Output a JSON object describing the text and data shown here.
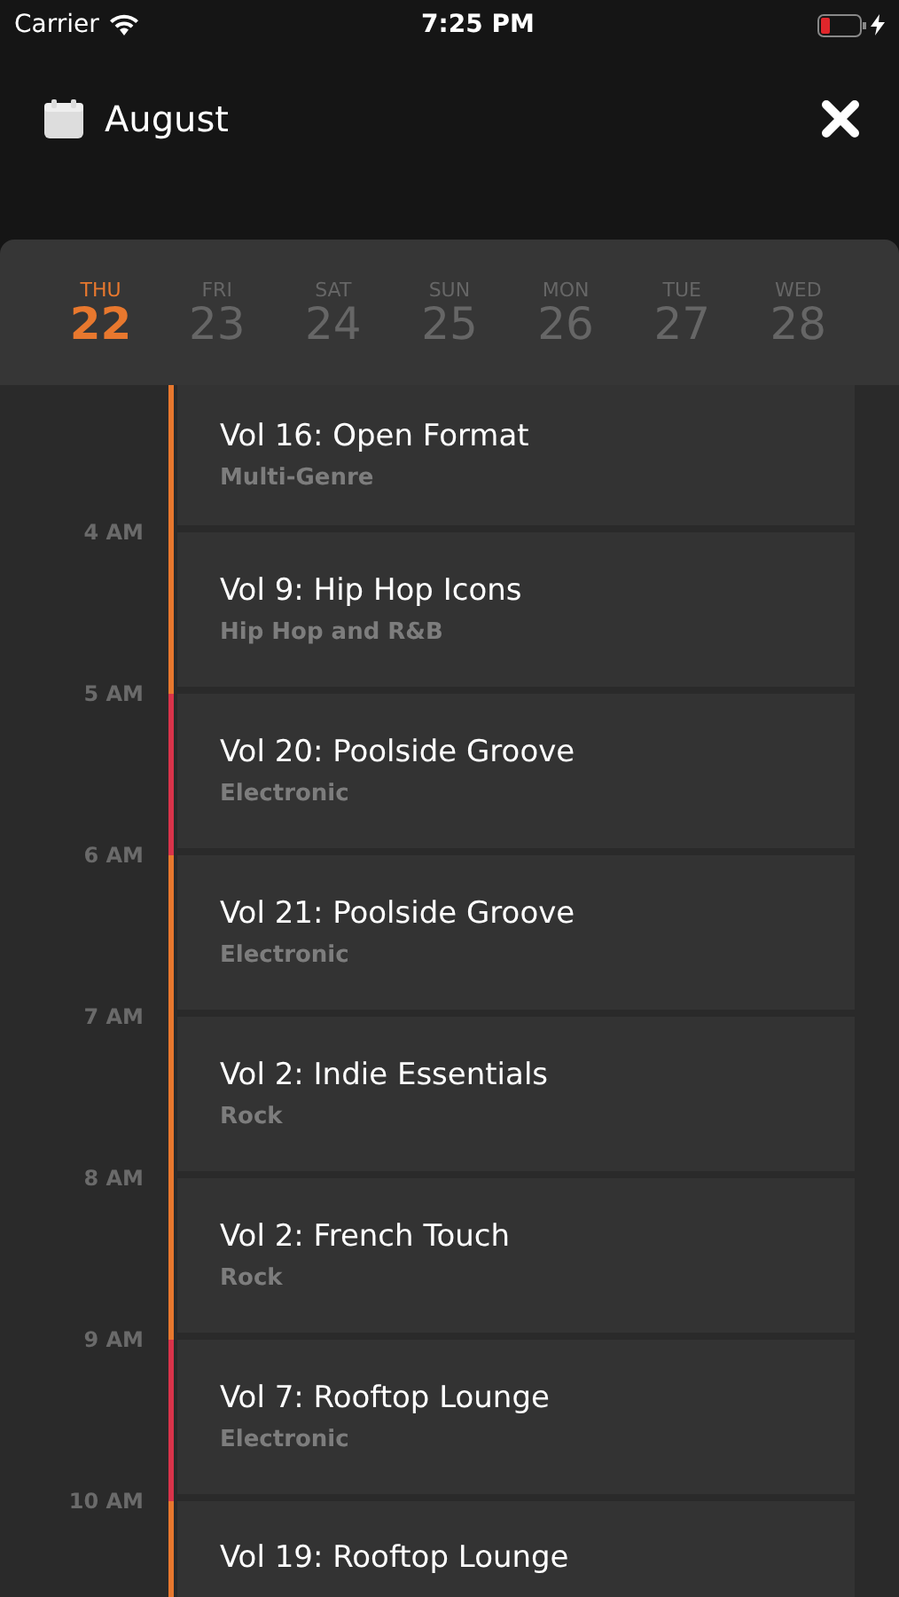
{
  "status_bar": {
    "carrier": "Carrier",
    "time": "7:25 PM"
  },
  "header": {
    "title": "August"
  },
  "days": [
    {
      "weekday": "THU",
      "date": "22",
      "selected": true
    },
    {
      "weekday": "FRI",
      "date": "23",
      "selected": false
    },
    {
      "weekday": "SAT",
      "date": "24",
      "selected": false
    },
    {
      "weekday": "SUN",
      "date": "25",
      "selected": false
    },
    {
      "weekday": "MON",
      "date": "26",
      "selected": false
    },
    {
      "weekday": "TUE",
      "date": "27",
      "selected": false
    },
    {
      "weekday": "WED",
      "date": "28",
      "selected": false
    }
  ],
  "events": [
    {
      "title": "Vol 16: Open Format",
      "genre": "Multi-Genre",
      "color": "#e8782e",
      "hour_below": "4 AM"
    },
    {
      "title": "Vol 9: Hip Hop Icons",
      "genre": "Hip Hop and R&B",
      "color": "#e8782e",
      "hour_below": "5 AM"
    },
    {
      "title": "Vol 20: Poolside Groove",
      "genre": "Electronic",
      "color": "#d9334a",
      "hour_below": "6 AM"
    },
    {
      "title": "Vol 21: Poolside Groove",
      "genre": "Electronic",
      "color": "#e8782e",
      "hour_below": "7 AM"
    },
    {
      "title": "Vol 2: Indie Essentials",
      "genre": "Rock",
      "color": "#e8782e",
      "hour_below": "8 AM"
    },
    {
      "title": "Vol 2: French Touch",
      "genre": "Rock",
      "color": "#e8782e",
      "hour_below": "9 AM"
    },
    {
      "title": "Vol 7: Rooftop Lounge",
      "genre": "Electronic",
      "color": "#d9334a",
      "hour_below": "10 AM"
    },
    {
      "title": "Vol 19: Rooftop Lounge",
      "color": "#e8782e"
    }
  ]
}
